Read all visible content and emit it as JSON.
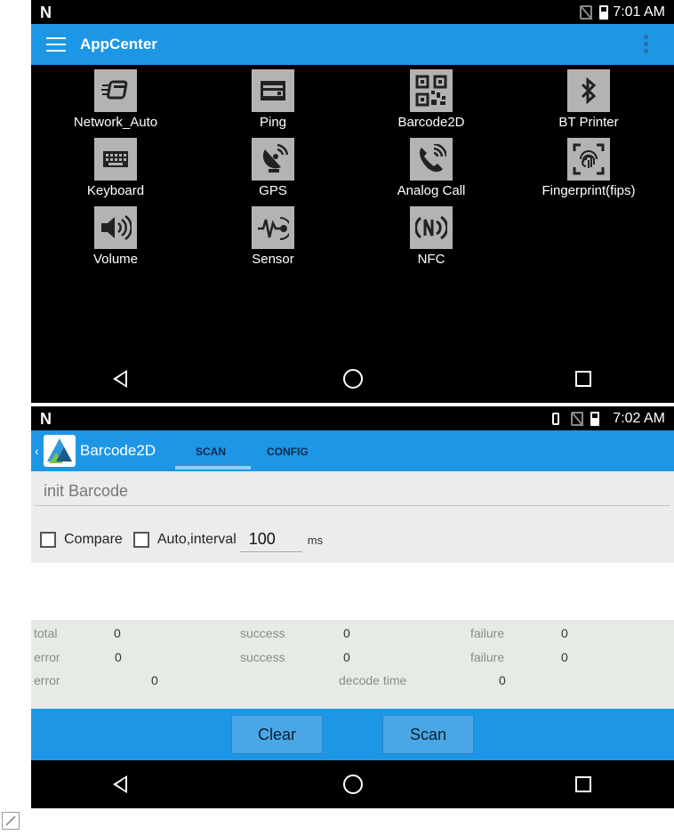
{
  "screen1": {
    "status": {
      "time": "7:01 AM"
    },
    "appbar": {
      "title": "AppCenter"
    },
    "apps": [
      {
        "label": "Network_Auto",
        "icon": "network-icon"
      },
      {
        "label": "Ping",
        "icon": "ping-icon"
      },
      {
        "label": "Barcode2D",
        "icon": "qrcode-icon"
      },
      {
        "label": "BT Printer",
        "icon": "bluetooth-icon"
      },
      {
        "label": "Keyboard",
        "icon": "keyboard-icon"
      },
      {
        "label": "GPS",
        "icon": "gps-icon"
      },
      {
        "label": "Analog Call",
        "icon": "phone-icon"
      },
      {
        "label": "Fingerprint(fips)",
        "icon": "fingerprint-icon"
      },
      {
        "label": "Volume",
        "icon": "volume-icon"
      },
      {
        "label": "Sensor",
        "icon": "sensor-icon"
      },
      {
        "label": "NFC",
        "icon": "nfc-icon"
      }
    ]
  },
  "screen2": {
    "status": {
      "time": "7:02 AM"
    },
    "appbar": {
      "title": "Barcode2D",
      "tabs": [
        "SCAN",
        "CONFIG"
      ]
    },
    "result": {
      "text": "init Barcode"
    },
    "options": {
      "compare": "Compare",
      "auto_interval": "Auto,interval",
      "interval_value": "100",
      "unit": "ms"
    },
    "stats": {
      "row1": {
        "total_label": "total",
        "total": "0",
        "success_label": "success",
        "success": "0",
        "failure_label": "failure",
        "failure": "0"
      },
      "row2": {
        "error_label": "error",
        "error": "0",
        "success_label": "success",
        "success": "0",
        "failure_label": "failure",
        "failure": "0"
      },
      "row3": {
        "error_label": "error",
        "error": "0",
        "decode_label": "decode time",
        "decode": "0"
      }
    },
    "buttons": {
      "clear": "Clear",
      "scan": "Scan"
    }
  },
  "colors": {
    "accent": "#1e96e6",
    "button": "#4aa6e4"
  }
}
